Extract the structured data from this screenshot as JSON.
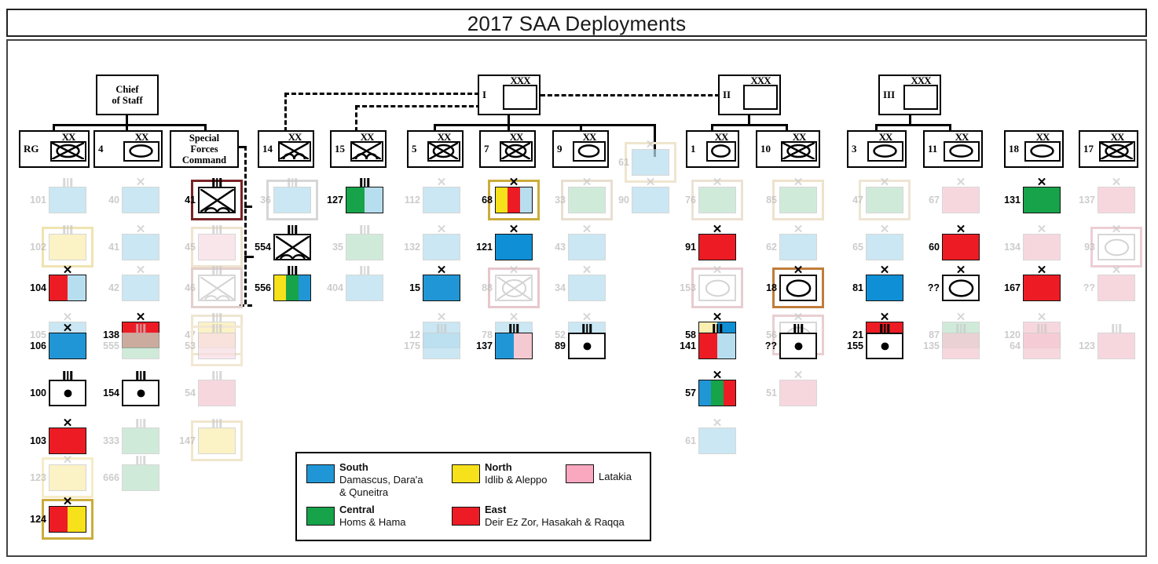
{
  "title": "2017 SAA Deployments",
  "colors": {
    "south": "#2196d6",
    "north": "#f7e11a",
    "central": "#16a34a",
    "east": "#ed1c24",
    "latakia": "#f9a8c0",
    "unknown": "#b7deef",
    "ghost_blue": "#b7deef",
    "ghost_green": "#bfe3cd",
    "ghost_pink": "#f5c9d2",
    "ghost_yellow": "#faeeb0"
  },
  "top": {
    "chief_of_staff": "Chief\nof Staff",
    "corps": [
      {
        "label": "I",
        "echelon": "XXX"
      },
      {
        "label": "II",
        "echelon": "XXX"
      },
      {
        "label": "III",
        "echelon": "XXX"
      }
    ]
  },
  "divisions": [
    {
      "id": "RG",
      "echelon": "XX",
      "symbol": "armor-mech"
    },
    {
      "id": "4",
      "echelon": "XX",
      "symbol": "mech"
    },
    {
      "id": "SFC",
      "echelon": "",
      "symbol": "text",
      "text": "Special\nForces\nCommand"
    },
    {
      "id": "14",
      "echelon": "XX",
      "symbol": "airborne"
    },
    {
      "id": "15",
      "echelon": "XX",
      "symbol": "airborne"
    },
    {
      "id": "5",
      "echelon": "XX",
      "symbol": "armor-mech"
    },
    {
      "id": "7",
      "echelon": "XX",
      "symbol": "armor-mech"
    },
    {
      "id": "9",
      "echelon": "XX",
      "symbol": "mech"
    },
    {
      "id": "1",
      "echelon": "XX",
      "symbol": "mech"
    },
    {
      "id": "10",
      "echelon": "XX",
      "symbol": "armor-mech"
    },
    {
      "id": "3",
      "echelon": "XX",
      "symbol": "mech"
    },
    {
      "id": "11",
      "echelon": "XX",
      "symbol": "mech"
    },
    {
      "id": "18",
      "echelon": "XX",
      "symbol": "mech"
    },
    {
      "id": "17",
      "echelon": "XX",
      "symbol": "armor-mech"
    }
  ],
  "legend": {
    "items": [
      {
        "name": "South",
        "color": "#2196d6",
        "desc": "Damascus, Dara'a",
        "desc2": "& Quneitra"
      },
      {
        "name": "Central",
        "color": "#16a34a",
        "desc": "Homs & Hama",
        "desc2": ""
      },
      {
        "name": "North",
        "color": "#f7e11a",
        "desc": "Idlib & Aleppo",
        "desc2": ""
      },
      {
        "name": "East",
        "color": "#ed1c24",
        "desc": "Deir Ez Zor, Hasakah & Raqqa",
        "desc2": ""
      },
      {
        "name": "",
        "color": "#f9a8c0",
        "desc": "Latakia",
        "desc2": ""
      }
    ]
  },
  "units": [
    {
      "id": "101",
      "col": 0,
      "row": 0,
      "size": "III",
      "faded": true,
      "segs": [
        "#b7deef"
      ]
    },
    {
      "id": "102",
      "col": 0,
      "row": 1,
      "size": "III",
      "faded": true,
      "segs": [
        "#faeeb0"
      ],
      "hl": "#f0e3b0"
    },
    {
      "id": "104",
      "col": 0,
      "row": 2,
      "size": "X",
      "faded": false,
      "segs": [
        "#ed1c24",
        "#b7deef"
      ]
    },
    {
      "id": "105",
      "col": 0,
      "row": 3,
      "size": "X",
      "faded": true,
      "segs": [
        "#b7deef"
      ]
    },
    {
      "id": "106",
      "col": 0,
      "row": 4,
      "size": "X",
      "faded": false,
      "segs": [
        "#2196d6"
      ]
    },
    {
      "id": "100",
      "col": 0,
      "row": 5,
      "size": "III",
      "faded": false,
      "segs": [
        "#ffffff"
      ],
      "dot": true
    },
    {
      "id": "103",
      "col": 0,
      "row": 6,
      "size": "X",
      "faded": false,
      "segs": [
        "#ed1c24"
      ]
    },
    {
      "id": "123",
      "col": 0,
      "row": 7,
      "size": "X",
      "faded": true,
      "segs": [
        "#faeeb0"
      ],
      "hl": "#f5ecc8"
    },
    {
      "id": "124",
      "col": 0,
      "row": 8,
      "size": "X",
      "faded": false,
      "segs": [
        "#ed1c24",
        "#f7e11a"
      ],
      "hl": "#cbac3c"
    },
    {
      "id": "40",
      "col": 1,
      "row": 0,
      "size": "X",
      "faded": true,
      "segs": [
        "#b7deef"
      ]
    },
    {
      "id": "41",
      "col": 1,
      "row": 1,
      "size": "X",
      "faded": true,
      "segs": [
        "#b7deef"
      ]
    },
    {
      "id": "42",
      "col": 1,
      "row": 2,
      "size": "X",
      "faded": true,
      "segs": [
        "#b7deef"
      ]
    },
    {
      "id": "138",
      "col": 1,
      "row": 3,
      "size": "X",
      "faded": false,
      "segs": [
        "#ed1c24"
      ]
    },
    {
      "id": "555",
      "col": 1,
      "row": 4,
      "size": "III",
      "faded": true,
      "segs": [
        "#bfe3cd"
      ]
    },
    {
      "id": "154",
      "col": 1,
      "row": 5,
      "size": "III",
      "faded": false,
      "segs": [
        "#ffffff"
      ],
      "dot": true
    },
    {
      "id": "333",
      "col": 1,
      "row": 6,
      "size": "III",
      "faded": true,
      "segs": [
        "#bfe3cd"
      ]
    },
    {
      "id": "666",
      "col": 1,
      "row": 7,
      "size": "III",
      "faded": true,
      "segs": [
        "#bfe3cd"
      ]
    },
    {
      "id": "41",
      "col": 2,
      "row": 0,
      "size": "III",
      "faded": false,
      "symbol": "airborne",
      "segs": [
        "#ffffff"
      ],
      "hl": "#7a2226"
    },
    {
      "id": "45",
      "col": 2,
      "row": 1,
      "size": "III",
      "faded": true,
      "segs": [
        "#f8dde4"
      ],
      "hl": "#efe3cf"
    },
    {
      "id": "46",
      "col": 2,
      "row": 2,
      "size": "III",
      "faded": true,
      "symbol": "airborne",
      "segs": [
        "#ffffff"
      ],
      "hl": "#e3cfcc"
    },
    {
      "id": "47",
      "col": 2,
      "row": 3,
      "size": "III",
      "faded": true,
      "segs": [
        "#faeeb0"
      ],
      "hl": "#efe6d2"
    },
    {
      "id": "53",
      "col": 2,
      "row": 4,
      "size": "III",
      "faded": true,
      "segs": [
        "#f8dde4"
      ],
      "hl": "#f3e8d4"
    },
    {
      "id": "54",
      "col": 2,
      "row": 5,
      "size": "III",
      "faded": true,
      "segs": [
        "#f5c9d2"
      ]
    },
    {
      "id": "147",
      "col": 2,
      "row": 6,
      "size": "III",
      "faded": true,
      "segs": [
        "#faeeb0"
      ],
      "hl": "#f0e6cc"
    },
    {
      "id": "36",
      "col": 3,
      "row": 0,
      "size": "III",
      "faded": true,
      "segs": [
        "#b7deef"
      ],
      "hl": "#d6d6d6"
    },
    {
      "id": "554",
      "col": 3,
      "row": 1,
      "size": "III",
      "faded": false,
      "symbol": "airborne",
      "segs": [
        "#ffffff"
      ]
    },
    {
      "id": "556",
      "col": 3,
      "row": 2,
      "size": "III",
      "faded": false,
      "segs": [
        "#f7e11a",
        "#16a34a",
        "#2196d6"
      ]
    },
    {
      "id": "127",
      "col": 4,
      "row": 0,
      "size": "III",
      "faded": false,
      "segs": [
        "#16a34a",
        "#b7deef"
      ]
    },
    {
      "id": "35",
      "col": 4,
      "row": 1,
      "size": "III",
      "faded": true,
      "segs": [
        "#bfe3cd"
      ]
    },
    {
      "id": "404",
      "col": 4,
      "row": 2,
      "size": "III",
      "faded": true,
      "segs": [
        "#b7deef"
      ]
    },
    {
      "id": "112",
      "col": 5,
      "row": 0,
      "size": "X",
      "faded": true,
      "segs": [
        "#b7deef"
      ]
    },
    {
      "id": "132",
      "col": 5,
      "row": 1,
      "size": "X",
      "faded": true,
      "segs": [
        "#b7deef"
      ]
    },
    {
      "id": "15",
      "col": 5,
      "row": 2,
      "size": "X",
      "faded": false,
      "segs": [
        "#2196d6"
      ]
    },
    {
      "id": "12",
      "col": 5,
      "row": 3,
      "size": "X",
      "faded": true,
      "segs": [
        "#b7deef"
      ]
    },
    {
      "id": "175",
      "col": 5,
      "row": 4,
      "size": "III",
      "faded": true,
      "segs": [
        "#b7deef"
      ]
    },
    {
      "id": "68",
      "col": 6,
      "row": 0,
      "size": "X",
      "faded": false,
      "segs": [
        "#f7e11a",
        "#ed1c24",
        "#b7deef"
      ],
      "hl": "#cbac3c"
    },
    {
      "id": "121",
      "col": 6,
      "row": 1,
      "size": "X",
      "faded": false,
      "segs": [
        "#0f8fd6"
      ]
    },
    {
      "id": "88",
      "col": 6,
      "row": 2,
      "size": "X",
      "faded": true,
      "symbol": "armor-mech",
      "segs": [
        "#ffffff"
      ],
      "hl": "#e6c8cc"
    },
    {
      "id": "78",
      "col": 6,
      "row": 3,
      "size": "X",
      "faded": true,
      "segs": [
        "#b7deef"
      ]
    },
    {
      "id": "137",
      "col": 6,
      "row": 4,
      "size": "III",
      "faded": false,
      "segs": [
        "#2196d6",
        "#f5c9d2"
      ]
    },
    {
      "id": "33",
      "col": 7,
      "row": 0,
      "size": "X",
      "faded": true,
      "segs": [
        "#bfe3cd"
      ],
      "hl": "#e9dfd0"
    },
    {
      "id": "43",
      "col": 7,
      "row": 1,
      "size": "X",
      "faded": true,
      "segs": [
        "#b7deef"
      ]
    },
    {
      "id": "34",
      "col": 7,
      "row": 2,
      "size": "X",
      "faded": true,
      "segs": [
        "#b7deef"
      ]
    },
    {
      "id": "52",
      "col": 7,
      "row": 3,
      "size": "X",
      "faded": true,
      "segs": [
        "#b7deef"
      ]
    },
    {
      "id": "89",
      "col": 7,
      "row": 4,
      "size": "III",
      "faded": false,
      "segs": [
        "#ffffff"
      ],
      "dot": true
    },
    {
      "id": "61",
      "col": 8,
      "row": -1,
      "size": "X",
      "faded": true,
      "segs": [
        "#b7deef"
      ],
      "hl": "#efe5cf"
    },
    {
      "id": "90",
      "col": 8,
      "row": 0,
      "size": "X",
      "faded": true,
      "segs": [
        "#b7deef"
      ]
    },
    {
      "id": "76",
      "col": 9,
      "row": 0,
      "size": "X",
      "faded": true,
      "segs": [
        "#bfe3cd"
      ],
      "hl": "#ece2d2"
    },
    {
      "id": "91",
      "col": 9,
      "row": 1,
      "size": "X",
      "faded": false,
      "segs": [
        "#ed1c24"
      ]
    },
    {
      "id": "153",
      "col": 9,
      "row": 2,
      "size": "X",
      "faded": true,
      "symbol": "mech",
      "segs": [
        "#ffffff"
      ],
      "hl": "#e8ccd0"
    },
    {
      "id": "58",
      "col": 9,
      "row": 3,
      "size": "X",
      "faded": false,
      "segs": [
        "#faeeb0",
        "#0f8fd6"
      ]
    },
    {
      "id": "141",
      "col": 9,
      "row": 4,
      "size": "III",
      "faded": false,
      "segs": [
        "#ed1c24",
        "#b7deef"
      ]
    },
    {
      "id": "57",
      "col": 9,
      "row": 5,
      "size": "X",
      "faded": false,
      "segs": [
        "#2196d6",
        "#16a34a",
        "#ed1c24"
      ]
    },
    {
      "id": "61",
      "col": 9,
      "row": 6,
      "size": "X",
      "faded": true,
      "segs": [
        "#b7deef"
      ]
    },
    {
      "id": "85",
      "col": 10,
      "row": 0,
      "size": "X",
      "faded": true,
      "segs": [
        "#bfe3cd"
      ],
      "hl": "#efe2cc"
    },
    {
      "id": "62",
      "col": 10,
      "row": 1,
      "size": "X",
      "faded": true,
      "segs": [
        "#b7deef"
      ]
    },
    {
      "id": "18",
      "col": 10,
      "row": 2,
      "size": "X",
      "faded": false,
      "symbol": "mech",
      "segs": [
        "#ffffff"
      ],
      "hl": "#c07c3a"
    },
    {
      "id": "56",
      "col": 10,
      "row": 3,
      "size": "X",
      "faded": true,
      "symbol": "mech",
      "segs": [
        "#ffffff"
      ],
      "hl": "#e9cfd2"
    },
    {
      "id": "??",
      "col": 10,
      "row": 4,
      "size": "III",
      "faded": false,
      "segs": [
        "#ffffff"
      ],
      "dot": true
    },
    {
      "id": "51",
      "col": 10,
      "row": 5,
      "size": "X",
      "faded": true,
      "segs": [
        "#f5c9d2"
      ]
    },
    {
      "id": "47",
      "col": 11,
      "row": 0,
      "size": "X",
      "faded": true,
      "segs": [
        "#bfe3cd"
      ],
      "hl": "#efe5d4"
    },
    {
      "id": "65",
      "col": 11,
      "row": 1,
      "size": "X",
      "faded": true,
      "segs": [
        "#b7deef"
      ]
    },
    {
      "id": "81",
      "col": 11,
      "row": 2,
      "size": "X",
      "faded": false,
      "segs": [
        "#0f8fd6"
      ]
    },
    {
      "id": "21",
      "col": 11,
      "row": 3,
      "size": "X",
      "faded": false,
      "segs": [
        "#ed1c24"
      ]
    },
    {
      "id": "155",
      "col": 11,
      "row": 4,
      "size": "III",
      "faded": false,
      "segs": [
        "#ffffff"
      ],
      "dot": true
    },
    {
      "id": "67",
      "col": 12,
      "row": 0,
      "size": "X",
      "faded": true,
      "segs": [
        "#f5c9d2"
      ]
    },
    {
      "id": "60",
      "col": 12,
      "row": 1,
      "size": "X",
      "faded": false,
      "segs": [
        "#ed1c24"
      ]
    },
    {
      "id": "??",
      "col": 12,
      "row": 2,
      "size": "X",
      "faded": false,
      "symbol": "mech",
      "segs": [
        "#ffffff"
      ]
    },
    {
      "id": "87",
      "col": 12,
      "row": 3,
      "size": "X",
      "faded": true,
      "segs": [
        "#bfe3cd"
      ]
    },
    {
      "id": "135",
      "col": 12,
      "row": 4,
      "size": "III",
      "faded": true,
      "segs": [
        "#f5c9d2"
      ]
    },
    {
      "id": "131",
      "col": 13,
      "row": 0,
      "size": "X",
      "faded": false,
      "segs": [
        "#16a34a"
      ]
    },
    {
      "id": "134",
      "col": 13,
      "row": 1,
      "size": "X",
      "faded": true,
      "segs": [
        "#f5c9d2"
      ]
    },
    {
      "id": "167",
      "col": 13,
      "row": 2,
      "size": "X",
      "faded": false,
      "segs": [
        "#ed1c24"
      ]
    },
    {
      "id": "120",
      "col": 13,
      "row": 3,
      "size": "X",
      "faded": true,
      "segs": [
        "#f5c9d2"
      ]
    },
    {
      "id": "64",
      "col": 13,
      "row": 4,
      "size": "III",
      "faded": true,
      "segs": [
        "#f5c9d2"
      ]
    },
    {
      "id": "137",
      "col": 14,
      "row": 0,
      "size": "X",
      "faded": true,
      "segs": [
        "#f5c9d2"
      ]
    },
    {
      "id": "93",
      "col": 14,
      "row": 1,
      "size": "X",
      "faded": true,
      "symbol": "mech",
      "segs": [
        "#ffffff"
      ],
      "hl": "#eccfd4"
    },
    {
      "id": "??",
      "col": 14,
      "row": 2,
      "size": "X",
      "faded": true,
      "segs": [
        "#f5c9d2"
      ]
    },
    {
      "id": "123",
      "col": 14,
      "row": 4,
      "size": "III",
      "faded": true,
      "segs": [
        "#f5c9d2"
      ]
    }
  ]
}
